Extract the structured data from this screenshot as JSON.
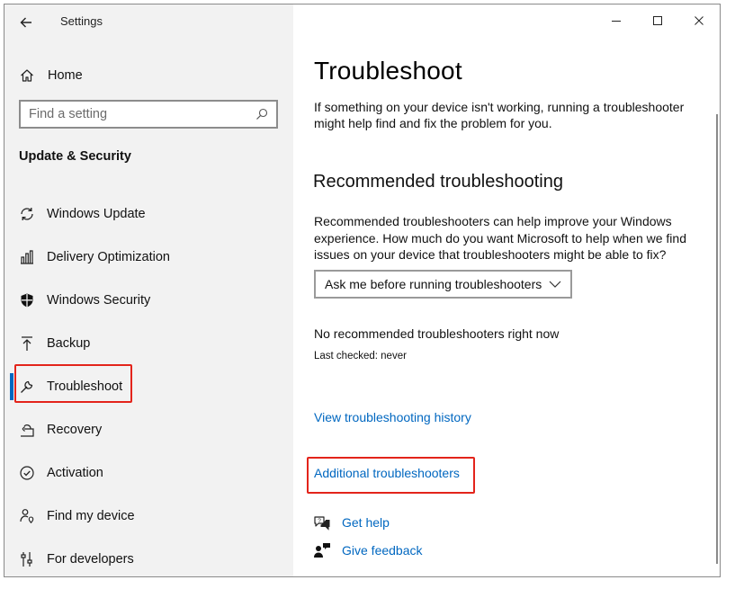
{
  "window": {
    "title": "Settings",
    "back_icon": "back-arrow-icon",
    "controls": [
      "minimize-icon",
      "maximize-icon",
      "close-icon"
    ]
  },
  "sidebar": {
    "home_label": "Home",
    "search_placeholder": "Find a setting",
    "section_title": "Update & Security",
    "items": [
      {
        "label": "Windows Update",
        "icon": "sync-icon"
      },
      {
        "label": "Delivery Optimization",
        "icon": "delivery-optimization-icon"
      },
      {
        "label": "Windows Security",
        "icon": "shield-icon"
      },
      {
        "label": "Backup",
        "icon": "upload-arrow-icon"
      },
      {
        "label": "Troubleshoot",
        "icon": "wrench-icon",
        "selected": true
      },
      {
        "label": "Recovery",
        "icon": "recovery-icon"
      },
      {
        "label": "Activation",
        "icon": "check-circle-icon"
      },
      {
        "label": "Find my device",
        "icon": "person-location-icon"
      },
      {
        "label": "For developers",
        "icon": "developer-sliders-icon"
      }
    ]
  },
  "main": {
    "title": "Troubleshoot",
    "intro": "If something on your device isn't working, running a troubleshooter might help find and fix the problem for you.",
    "recommended_heading": "Recommended troubleshooting",
    "recommended_desc": "Recommended troubleshooters can help improve your Windows experience. How much do you want Microsoft to help when we find issues on your device that troubleshooters might be able to fix?",
    "dropdown_value": "Ask me before running troubleshooters",
    "no_recommended": "No recommended troubleshooters right now",
    "last_checked": "Last checked: never",
    "history_link": "View troubleshooting history",
    "additional_link": "Additional troubleshooters",
    "get_help": "Get help",
    "give_feedback": "Give feedback"
  },
  "colors": {
    "accent": "#0067c0",
    "highlight_box": "#e3241b",
    "sidebar_bg": "#f2f2f2"
  }
}
